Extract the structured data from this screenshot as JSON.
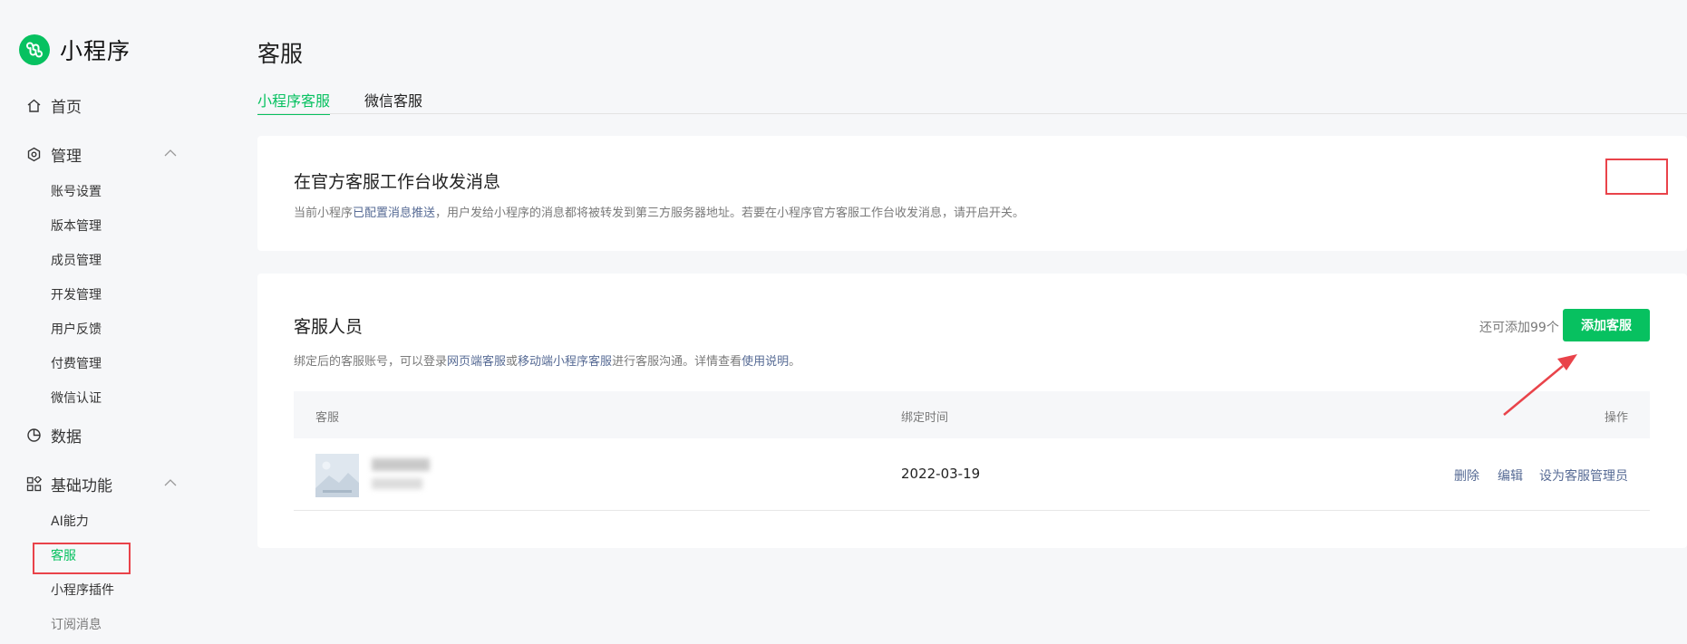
{
  "brand": {
    "name": "小程序"
  },
  "sidebar": {
    "home": "首页",
    "manage": "管理",
    "manage_items": [
      "账号设置",
      "版本管理",
      "成员管理",
      "开发管理",
      "用户反馈",
      "付费管理",
      "微信认证"
    ],
    "data": "数据",
    "basic": "基础功能",
    "basic_items": [
      "AI能力",
      "客服",
      "小程序插件",
      "订阅消息"
    ]
  },
  "page": {
    "title": "客服"
  },
  "tabs": [
    {
      "label": "小程序客服",
      "active": true
    },
    {
      "label": "微信客服",
      "active": false
    }
  ],
  "card1": {
    "title": "在官方客服工作台收发消息",
    "desc_before": "当前小程序",
    "desc_link": "已配置消息推送",
    "desc_after": "，用户发给小程序的消息都将被转发到第三方服务器地址。若要在小程序官方客服工作台收发消息，请开启开关。",
    "toggle_on": true
  },
  "card2": {
    "title": "客服人员",
    "desc_1": "绑定后的客服账号，可以登录",
    "link_1": "网页端客服",
    "desc_2": "或",
    "link_2": "移动端小程序客服",
    "desc_3": "进行客服沟通。详情查看",
    "link_3": "使用说明",
    "desc_4": "。",
    "remaining": "还可添加99个",
    "add_button": "添加客服",
    "columns": {
      "agent": "客服",
      "bind_time": "绑定时间",
      "actions": "操作"
    },
    "rows": [
      {
        "bind_time": "2022-03-19",
        "actions": [
          "删除",
          "编辑",
          "设为客服管理员"
        ]
      }
    ]
  },
  "colors": {
    "accent": "#07c160",
    "link": "#576b95",
    "annotation": "#e9434a"
  }
}
